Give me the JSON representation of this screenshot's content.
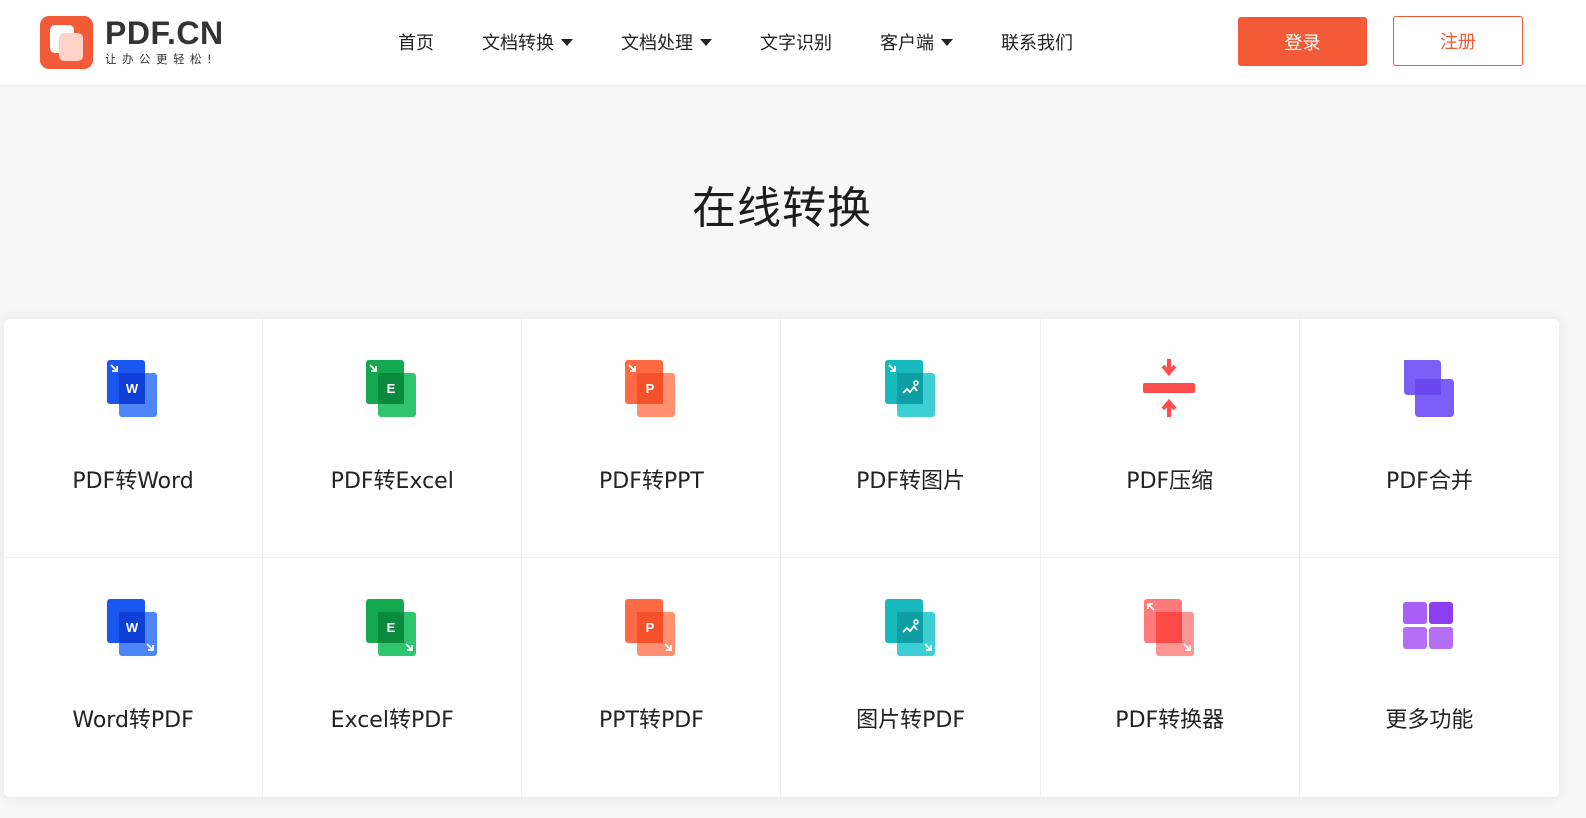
{
  "brand": {
    "name": "PDF.CN",
    "slogan": "让办公更轻松!",
    "color": "#f25a38"
  },
  "nav": [
    {
      "label": "首页",
      "dropdown": false
    },
    {
      "label": "文档转换",
      "dropdown": true
    },
    {
      "label": "文档处理",
      "dropdown": true
    },
    {
      "label": "文字识别",
      "dropdown": false
    },
    {
      "label": "客户端",
      "dropdown": true
    },
    {
      "label": "联系我们",
      "dropdown": false
    }
  ],
  "auth": {
    "login": "登录",
    "register": "注册"
  },
  "page": {
    "title": "在线转换"
  },
  "tools": [
    {
      "label": "PDF转Word",
      "icon": "pdf-to-word-icon",
      "color": "#2b6cf6"
    },
    {
      "label": "PDF转Excel",
      "icon": "pdf-to-excel-icon",
      "color": "#17b35a"
    },
    {
      "label": "PDF转PPT",
      "icon": "pdf-to-ppt-icon",
      "color": "#ff6a45"
    },
    {
      "label": "PDF转图片",
      "icon": "pdf-to-image-icon",
      "color": "#19bfc2"
    },
    {
      "label": "PDF压缩",
      "icon": "compress-icon",
      "color": "#ff5252"
    },
    {
      "label": "PDF合并",
      "icon": "merge-icon",
      "color": "#7b5ef5"
    },
    {
      "label": "Word转PDF",
      "icon": "word-to-pdf-icon",
      "color": "#2b6cf6"
    },
    {
      "label": "Excel转PDF",
      "icon": "excel-to-pdf-icon",
      "color": "#17b35a"
    },
    {
      "label": "PPT转PDF",
      "icon": "ppt-to-pdf-icon",
      "color": "#ff6a45"
    },
    {
      "label": "图片转PDF",
      "icon": "image-to-pdf-icon",
      "color": "#19bfc2"
    },
    {
      "label": "PDF转换器",
      "icon": "pdf-converter-icon",
      "color": "#ff4d4d"
    },
    {
      "label": "更多功能",
      "icon": "more-features-icon",
      "color": "#9b5cf2"
    }
  ]
}
